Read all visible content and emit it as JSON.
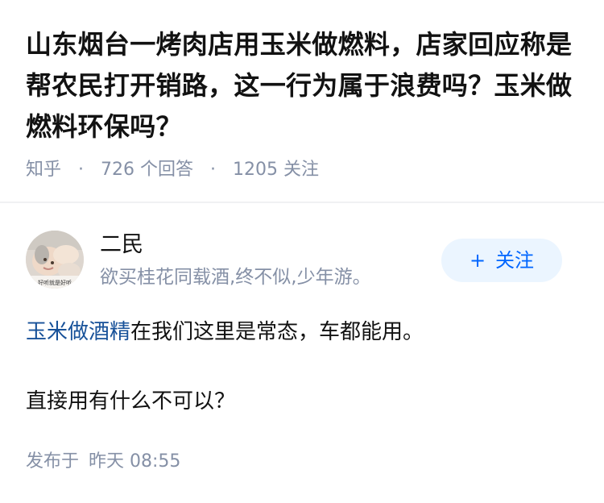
{
  "question": {
    "title": "山东烟台一烤肉店用玉米做燃料，店家回应称是帮农民打开销路，这一行为属于浪费吗？玉米做燃料环保吗？",
    "source": "知乎",
    "separator": "·",
    "answers_count": "726",
    "answers_label": "个回答",
    "followers_count": "1205",
    "followers_label": "关注"
  },
  "answer": {
    "author": {
      "name": "二民",
      "bio": "欲买桂花同载酒,终不似,少年游。",
      "avatar_caption": "好听就是好听",
      "follow_icon": "plus-icon",
      "follow_label": "关注"
    },
    "body": {
      "p1_link": "玉米做酒精",
      "p1_text": "在我们这里是常态，车都能用。",
      "p2_text": "直接用有什么不可以？"
    },
    "published_label": "发布于",
    "published_time": "昨天 08:55"
  },
  "colors": {
    "link": "#175199",
    "follow_button_text": "#0066ff",
    "follow_button_bg": "#ebf5ff",
    "meta_text": "#8590a6",
    "title_text": "#121212"
  }
}
